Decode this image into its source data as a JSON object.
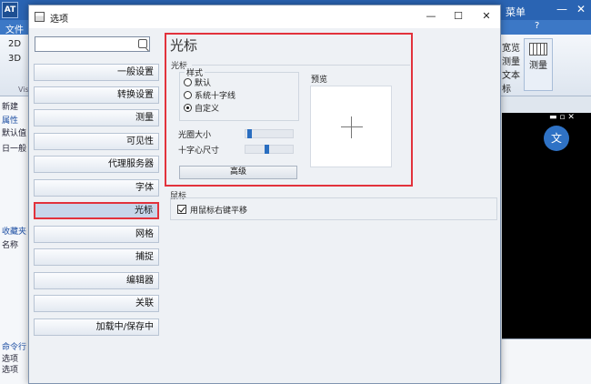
{
  "app": {
    "logo": "AT",
    "menu_label": "菜单",
    "file_tab": "文件",
    "ribbon": {
      "right_labels": [
        "宽览",
        "测量",
        "文本",
        "标"
      ],
      "measure": "测量",
      "left_tab_2d": "2D",
      "left_tab_3d": "3D",
      "vis_label": "Vis"
    },
    "left_panel": {
      "new_label": "新建",
      "attributes": "属性",
      "default": "默认值",
      "general": "日一般",
      "favorites": "收藏夹",
      "name": "名称",
      "command": "命令行",
      "cmd_lines": [
        "选项",
        "选项"
      ]
    }
  },
  "dialog": {
    "title": "选项",
    "search": {
      "value": "",
      "placeholder": ""
    },
    "nav": [
      {
        "label": "一般设置"
      },
      {
        "label": "转换设置"
      },
      {
        "label": "测量"
      },
      {
        "label": "可见性"
      },
      {
        "label": "代理服务器"
      },
      {
        "label": "字体"
      },
      {
        "label": "光标",
        "active": true
      },
      {
        "label": "网格"
      },
      {
        "label": "捕捉"
      },
      {
        "label": "编辑器"
      },
      {
        "label": "关联"
      },
      {
        "label": "加载中/保存中"
      }
    ],
    "cursor": {
      "title": "光标",
      "subsection": "光标",
      "style_legend": "样式",
      "options": [
        {
          "label": "默认",
          "checked": false
        },
        {
          "label": "系统十字线",
          "checked": false
        },
        {
          "label": "自定义",
          "checked": true
        }
      ],
      "preview_label": "预览",
      "aperture_label": "光圈大小",
      "aperture_value": 0.05,
      "crosshair_label": "十字心尺寸",
      "crosshair_value": 0.45,
      "advanced_button": "高级"
    },
    "mouse": {
      "title": "鼠标",
      "pan_label": "用鼠标右键平移",
      "pan_checked": true
    }
  },
  "colors": {
    "highlight_border": "#e2323c",
    "slider_thumb": "#2a6ec0",
    "title_bar": "#2a64b3"
  }
}
